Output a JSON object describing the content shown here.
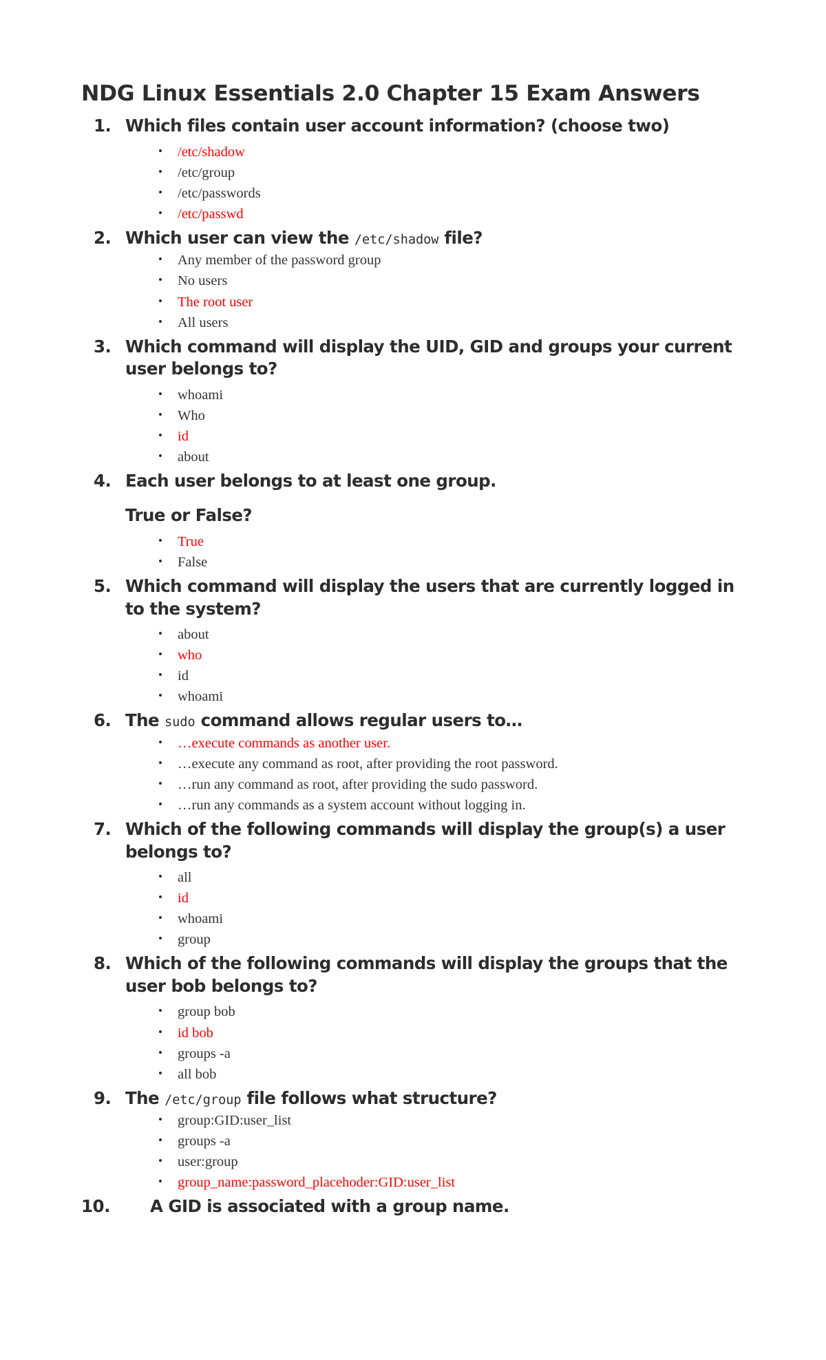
{
  "document": {
    "title": "NDG Linux Essentials 2.0 Chapter 15 Exam Answers",
    "correct_answer_color": "#ff0000",
    "text_color": "#2d2d2d"
  },
  "questions": [
    {
      "number": "1.",
      "text": "Which files contain user account information? (choose two)",
      "answers": [
        {
          "label": "/etc/shadow",
          "correct": true
        },
        {
          "label": "/etc/group",
          "correct": false
        },
        {
          "label": "/etc/passwords",
          "correct": false
        },
        {
          "label": "/etc/passwd",
          "correct": true
        }
      ]
    },
    {
      "number": "2.",
      "text_before": "Which user can view the ",
      "code": "/etc/shadow",
      "text_after": " file?",
      "answers": [
        {
          "label": "Any member of the password group",
          "correct": false
        },
        {
          "label": "No users",
          "correct": false
        },
        {
          "label": "The root user",
          "correct": true
        },
        {
          "label": "All users",
          "correct": false
        }
      ]
    },
    {
      "number": "3.",
      "text": "Which command will display the UID, GID and groups your current user belongs to?",
      "answers": [
        {
          "label": "whoami",
          "correct": false
        },
        {
          "label": "Who",
          "correct": false
        },
        {
          "label": "id",
          "correct": true
        },
        {
          "label": "about",
          "correct": false
        }
      ]
    },
    {
      "number": "4.",
      "text": "Each user belongs to at least one group.",
      "text2": "True or False?",
      "answers": [
        {
          "label": "True",
          "correct": true
        },
        {
          "label": "False",
          "correct": false
        }
      ]
    },
    {
      "number": "5.",
      "text": "Which command will display the users that are currently logged in to the system?",
      "answers": [
        {
          "label": "about",
          "correct": false
        },
        {
          "label": "who",
          "correct": true
        },
        {
          "label": "id",
          "correct": false
        },
        {
          "label": "whoami",
          "correct": false
        }
      ]
    },
    {
      "number": "6.",
      "text_before": "The ",
      "code": "sudo",
      "text_after": " command allows regular users to…",
      "answers": [
        {
          "label": "…execute commands as another user.",
          "correct": true
        },
        {
          "label": "…execute any command as root, after providing the root password.",
          "correct": false
        },
        {
          "label": "…run any command as root, after providing the sudo password.",
          "correct": false
        },
        {
          "label": "…run any commands as a system account without logging in.",
          "correct": false
        }
      ]
    },
    {
      "number": "7.",
      "text": "Which of the following commands will display the group(s) a user belongs to?",
      "answers": [
        {
          "label": "all",
          "correct": false
        },
        {
          "label": "id",
          "correct": true
        },
        {
          "label": "whoami",
          "correct": false
        },
        {
          "label": "group",
          "correct": false
        }
      ]
    },
    {
      "number": "8.",
      "text": "Which of the following commands will display the groups that the user bob belongs to?",
      "answers": [
        {
          "label": "group bob",
          "correct": false
        },
        {
          "label": "id bob",
          "correct": true
        },
        {
          "label": "groups -a",
          "correct": false
        },
        {
          "label": "all bob",
          "correct": false
        }
      ]
    },
    {
      "number": "9.",
      "text_before": "The ",
      "code": "/etc/group",
      "text_after": " file follows what structure?",
      "answers": [
        {
          "label": "group:GID:user_list",
          "correct": false
        },
        {
          "label": "groups -a",
          "correct": false
        },
        {
          "label": "user:group",
          "correct": false
        },
        {
          "label": "group_name:password_placehoder:GID:user_list",
          "correct": true
        }
      ]
    },
    {
      "number": "10.",
      "text": "A GID is associated with a group name.",
      "answers": []
    }
  ]
}
